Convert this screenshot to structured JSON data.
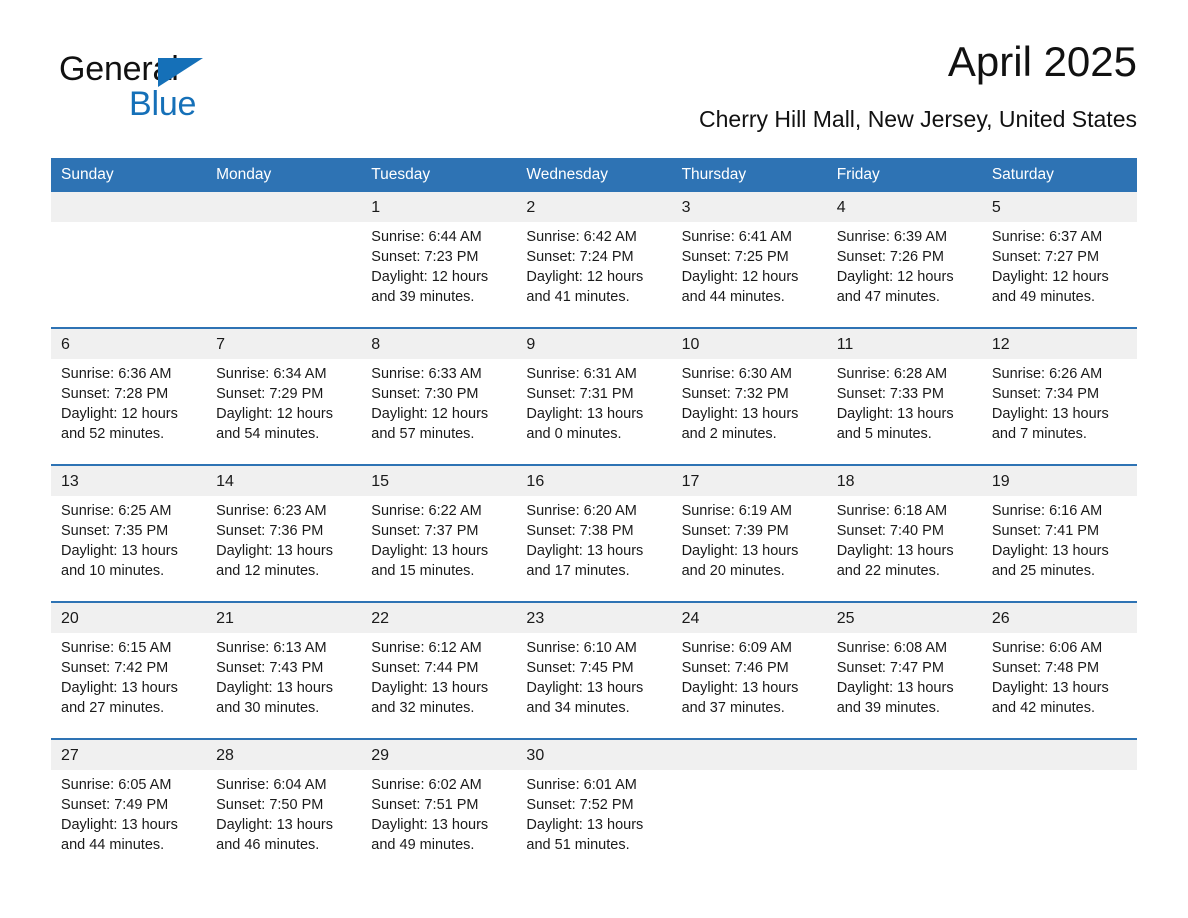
{
  "brand": {
    "name_part1": "General",
    "name_part2": "Blue",
    "logo_icon": "triangle-logo-icon",
    "accent_color": "#1570b8"
  },
  "header": {
    "title": "April 2025",
    "subtitle": "Cherry Hill Mall, New Jersey, United States"
  },
  "theme": {
    "header_bg": "#2e73b4",
    "daynum_bg": "#f0f0f0",
    "text": "#1a1a1a"
  },
  "calendar": {
    "weekday_headers": [
      "Sunday",
      "Monday",
      "Tuesday",
      "Wednesday",
      "Thursday",
      "Friday",
      "Saturday"
    ],
    "weeks": [
      [
        {
          "day": "",
          "lines": []
        },
        {
          "day": "",
          "lines": []
        },
        {
          "day": "1",
          "lines": [
            "Sunrise: 6:44 AM",
            "Sunset: 7:23 PM",
            "Daylight: 12 hours",
            "and 39 minutes."
          ]
        },
        {
          "day": "2",
          "lines": [
            "Sunrise: 6:42 AM",
            "Sunset: 7:24 PM",
            "Daylight: 12 hours",
            "and 41 minutes."
          ]
        },
        {
          "day": "3",
          "lines": [
            "Sunrise: 6:41 AM",
            "Sunset: 7:25 PM",
            "Daylight: 12 hours",
            "and 44 minutes."
          ]
        },
        {
          "day": "4",
          "lines": [
            "Sunrise: 6:39 AM",
            "Sunset: 7:26 PM",
            "Daylight: 12 hours",
            "and 47 minutes."
          ]
        },
        {
          "day": "5",
          "lines": [
            "Sunrise: 6:37 AM",
            "Sunset: 7:27 PM",
            "Daylight: 12 hours",
            "and 49 minutes."
          ]
        }
      ],
      [
        {
          "day": "6",
          "lines": [
            "Sunrise: 6:36 AM",
            "Sunset: 7:28 PM",
            "Daylight: 12 hours",
            "and 52 minutes."
          ]
        },
        {
          "day": "7",
          "lines": [
            "Sunrise: 6:34 AM",
            "Sunset: 7:29 PM",
            "Daylight: 12 hours",
            "and 54 minutes."
          ]
        },
        {
          "day": "8",
          "lines": [
            "Sunrise: 6:33 AM",
            "Sunset: 7:30 PM",
            "Daylight: 12 hours",
            "and 57 minutes."
          ]
        },
        {
          "day": "9",
          "lines": [
            "Sunrise: 6:31 AM",
            "Sunset: 7:31 PM",
            "Daylight: 13 hours",
            "and 0 minutes."
          ]
        },
        {
          "day": "10",
          "lines": [
            "Sunrise: 6:30 AM",
            "Sunset: 7:32 PM",
            "Daylight: 13 hours",
            "and 2 minutes."
          ]
        },
        {
          "day": "11",
          "lines": [
            "Sunrise: 6:28 AM",
            "Sunset: 7:33 PM",
            "Daylight: 13 hours",
            "and 5 minutes."
          ]
        },
        {
          "day": "12",
          "lines": [
            "Sunrise: 6:26 AM",
            "Sunset: 7:34 PM",
            "Daylight: 13 hours",
            "and 7 minutes."
          ]
        }
      ],
      [
        {
          "day": "13",
          "lines": [
            "Sunrise: 6:25 AM",
            "Sunset: 7:35 PM",
            "Daylight: 13 hours",
            "and 10 minutes."
          ]
        },
        {
          "day": "14",
          "lines": [
            "Sunrise: 6:23 AM",
            "Sunset: 7:36 PM",
            "Daylight: 13 hours",
            "and 12 minutes."
          ]
        },
        {
          "day": "15",
          "lines": [
            "Sunrise: 6:22 AM",
            "Sunset: 7:37 PM",
            "Daylight: 13 hours",
            "and 15 minutes."
          ]
        },
        {
          "day": "16",
          "lines": [
            "Sunrise: 6:20 AM",
            "Sunset: 7:38 PM",
            "Daylight: 13 hours",
            "and 17 minutes."
          ]
        },
        {
          "day": "17",
          "lines": [
            "Sunrise: 6:19 AM",
            "Sunset: 7:39 PM",
            "Daylight: 13 hours",
            "and 20 minutes."
          ]
        },
        {
          "day": "18",
          "lines": [
            "Sunrise: 6:18 AM",
            "Sunset: 7:40 PM",
            "Daylight: 13 hours",
            "and 22 minutes."
          ]
        },
        {
          "day": "19",
          "lines": [
            "Sunrise: 6:16 AM",
            "Sunset: 7:41 PM",
            "Daylight: 13 hours",
            "and 25 minutes."
          ]
        }
      ],
      [
        {
          "day": "20",
          "lines": [
            "Sunrise: 6:15 AM",
            "Sunset: 7:42 PM",
            "Daylight: 13 hours",
            "and 27 minutes."
          ]
        },
        {
          "day": "21",
          "lines": [
            "Sunrise: 6:13 AM",
            "Sunset: 7:43 PM",
            "Daylight: 13 hours",
            "and 30 minutes."
          ]
        },
        {
          "day": "22",
          "lines": [
            "Sunrise: 6:12 AM",
            "Sunset: 7:44 PM",
            "Daylight: 13 hours",
            "and 32 minutes."
          ]
        },
        {
          "day": "23",
          "lines": [
            "Sunrise: 6:10 AM",
            "Sunset: 7:45 PM",
            "Daylight: 13 hours",
            "and 34 minutes."
          ]
        },
        {
          "day": "24",
          "lines": [
            "Sunrise: 6:09 AM",
            "Sunset: 7:46 PM",
            "Daylight: 13 hours",
            "and 37 minutes."
          ]
        },
        {
          "day": "25",
          "lines": [
            "Sunrise: 6:08 AM",
            "Sunset: 7:47 PM",
            "Daylight: 13 hours",
            "and 39 minutes."
          ]
        },
        {
          "day": "26",
          "lines": [
            "Sunrise: 6:06 AM",
            "Sunset: 7:48 PM",
            "Daylight: 13 hours",
            "and 42 minutes."
          ]
        }
      ],
      [
        {
          "day": "27",
          "lines": [
            "Sunrise: 6:05 AM",
            "Sunset: 7:49 PM",
            "Daylight: 13 hours",
            "and 44 minutes."
          ]
        },
        {
          "day": "28",
          "lines": [
            "Sunrise: 6:04 AM",
            "Sunset: 7:50 PM",
            "Daylight: 13 hours",
            "and 46 minutes."
          ]
        },
        {
          "day": "29",
          "lines": [
            "Sunrise: 6:02 AM",
            "Sunset: 7:51 PM",
            "Daylight: 13 hours",
            "and 49 minutes."
          ]
        },
        {
          "day": "30",
          "lines": [
            "Sunrise: 6:01 AM",
            "Sunset: 7:52 PM",
            "Daylight: 13 hours",
            "and 51 minutes."
          ]
        },
        {
          "day": "",
          "lines": []
        },
        {
          "day": "",
          "lines": []
        },
        {
          "day": "",
          "lines": []
        }
      ]
    ]
  }
}
